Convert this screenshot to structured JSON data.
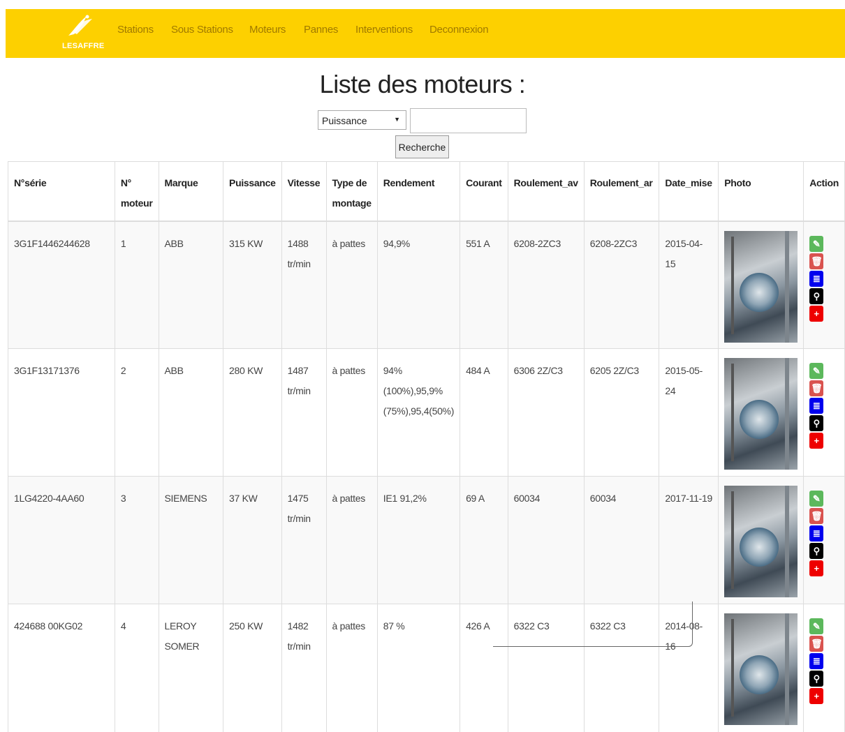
{
  "brand": {
    "name": "LESAFFRE"
  },
  "nav": [
    "Stations",
    "Sous Stations",
    "Moteurs",
    "Pannes",
    "Interventions",
    "Deconnexion"
  ],
  "page": {
    "title": "Liste des moteurs :"
  },
  "search": {
    "selected": "Puissance",
    "value": "",
    "button": "Recherche"
  },
  "table": {
    "headers": [
      "N°série",
      "N° moteur",
      "Marque",
      "Puissance",
      "Vitesse",
      "Type de montage",
      "Rendement",
      "Courant",
      "Roulement_av",
      "Roulement_ar",
      "Date_mise",
      "Photo",
      "Action"
    ],
    "rows": [
      {
        "serie": "3G1F1446244628",
        "num": "1",
        "marque": "ABB",
        "puissance": "315 KW",
        "vitesse": "1488 tr/min",
        "montage": "à pattes",
        "rendement": "94,9%",
        "courant": "551 A",
        "roul_av": "6208-2ZC3",
        "roul_ar": "6208-2ZC3",
        "date": "2015-04-15"
      },
      {
        "serie": "3G1F13171376",
        "num": "2",
        "marque": "ABB",
        "puissance": "280 KW",
        "vitesse": "1487 tr/min",
        "montage": "à pattes",
        "rendement": "94% (100%),95,9% (75%),95,4(50%)",
        "courant": "484 A",
        "roul_av": "6306 2Z/C3",
        "roul_ar": "6205 2Z/C3",
        "date": "2015-05-24"
      },
      {
        "serie": "1LG4220-4AA60",
        "num": "3",
        "marque": "SIEMENS",
        "puissance": "37 KW",
        "vitesse": "1475 tr/min",
        "montage": "à pattes",
        "rendement": "IE1 91,2%",
        "courant": "69 A",
        "roul_av": "60034",
        "roul_ar": "60034",
        "date": "2017-11-19"
      },
      {
        "serie": "424688 00KG02",
        "num": "4",
        "marque": "LEROY SOMER",
        "puissance": "250 KW",
        "vitesse": "1482 tr/min",
        "montage": "à pattes",
        "rendement": "87 %",
        "courant": "426 A",
        "roul_av": "6322 C3",
        "roul_ar": "6322 C3",
        "date": "2014-08-16"
      }
    ]
  },
  "actions": [
    "pencil-icon",
    "trash-icon",
    "list-icon",
    "search-icon",
    "plus-icon"
  ],
  "colors": {
    "navbar": "#fdd000",
    "nav_text": "#a07a00",
    "edit": "#5cb85c",
    "delete": "#d9534f",
    "list": "#0000ee",
    "view": "#000000",
    "add": "#ee0000"
  }
}
